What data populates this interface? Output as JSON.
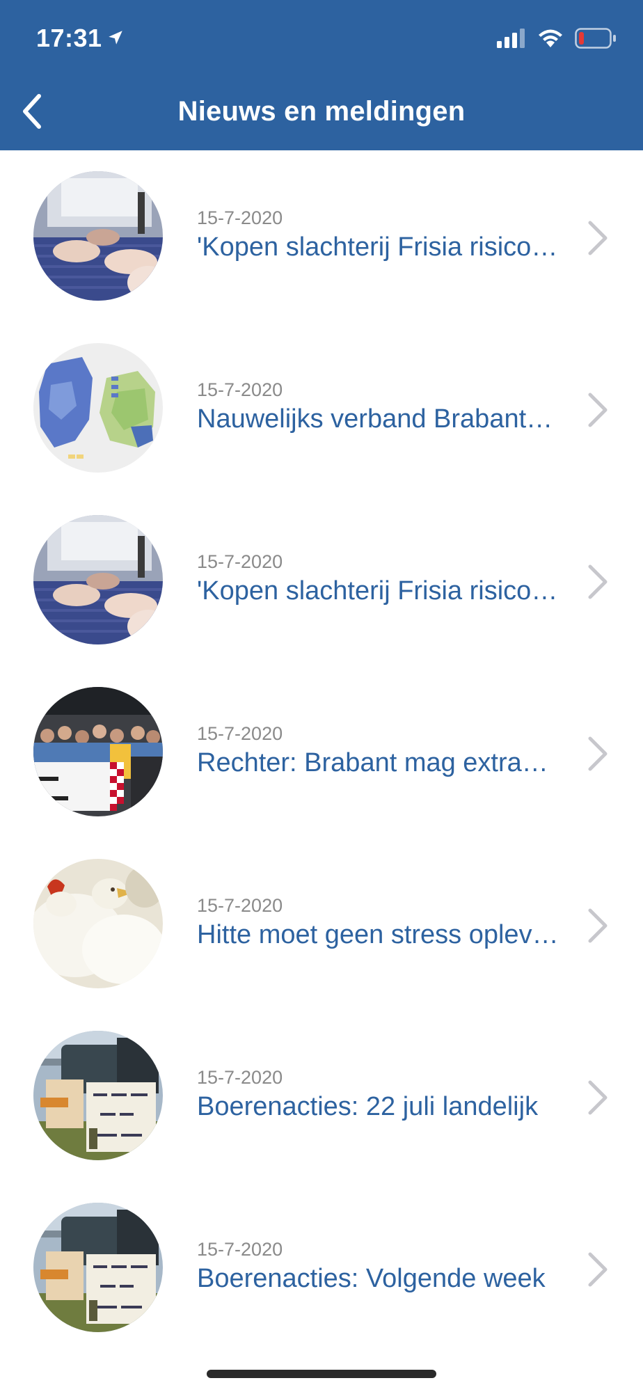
{
  "status_bar": {
    "time": "17:31"
  },
  "nav": {
    "title": "Nieuws en meldingen"
  },
  "colors": {
    "header_bg": "#2d62a0",
    "title_link": "#2d62a0",
    "date_gray": "#8a8a8a",
    "chevron": "#c7c7cc"
  },
  "items": [
    {
      "date": "15-7-2020",
      "title": "'Kopen slachterij Frisia risicovol'",
      "thumbnail": "meat-conveyor"
    },
    {
      "date": "15-7-2020",
      "title": "Nauwelijks verband Brabant…",
      "thumbnail": "netherlands-map"
    },
    {
      "date": "15-7-2020",
      "title": "'Kopen slachterij Frisia risicovol'",
      "thumbnail": "meat-conveyor"
    },
    {
      "date": "15-7-2020",
      "title": "Rechter: Brabant mag extra…",
      "thumbnail": "protest-crowd"
    },
    {
      "date": "15-7-2020",
      "title": "Hitte moet geen stress opleveren",
      "thumbnail": "white-chickens"
    },
    {
      "date": "15-7-2020",
      "title": "Boerenacties: 22 juli landelijk",
      "thumbnail": "farmer-protest-signs"
    },
    {
      "date": "15-7-2020",
      "title": "Boerenacties: Volgende week",
      "thumbnail": "farmer-protest-signs"
    }
  ]
}
